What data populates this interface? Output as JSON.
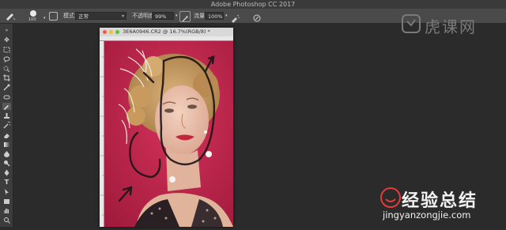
{
  "app": {
    "title": "Adobe Photoshop CC 2017"
  },
  "options_bar": {
    "brush_size": "100",
    "mode_label": "模式:",
    "mode_value": "正常",
    "opacity_label": "不透明度:",
    "opacity_value": "99%",
    "flow_label": "流量:",
    "flow_value": "100%"
  },
  "document": {
    "tab_title": "3E6A0946.CR2 @ 16.7%(RGB/8) *"
  },
  "tools": [
    "move-tool",
    "artboard-tool",
    "marquee-tool",
    "lasso-tool",
    "quick-select-tool",
    "crop-tool",
    "eyedropper-tool",
    "healing-tool",
    "brush-tool",
    "clone-stamp-tool",
    "history-brush-tool",
    "eraser-tool",
    "gradient-tool",
    "blur-tool",
    "dodge-tool",
    "pen-tool",
    "type-tool",
    "path-select-tool",
    "rectangle-tool",
    "hand-tool"
  ],
  "watermark": {
    "top_text": "虎课网",
    "cn_text": "经验总结",
    "url_text": "jingyanzongjie.com"
  },
  "colors": {
    "accent_red": "#e53a3a",
    "photo_bg": "#c4244c"
  }
}
